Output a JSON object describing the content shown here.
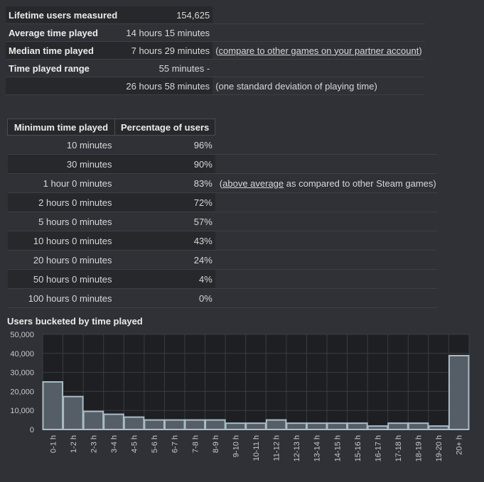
{
  "stats": {
    "rows": [
      {
        "label": "Lifetime users measured",
        "value": "154,625",
        "note": ""
      },
      {
        "label": "Average time played",
        "value": "14 hours 15 minutes",
        "note": ""
      },
      {
        "label": "Median time played",
        "value": "7 hours 29 minutes",
        "note_prefix": "(",
        "note_link": "compare to other games on your partner account",
        "note_suffix": ")"
      },
      {
        "label": "Time played range",
        "value": "55 minutes -",
        "note": ""
      },
      {
        "label": "",
        "value": "26 hours 58 minutes",
        "note": "(one standard deviation of playing time)"
      }
    ]
  },
  "time_played": {
    "headers": [
      "Minimum time played",
      "Percentage of users"
    ],
    "rows": [
      {
        "min": "10 minutes",
        "pct": "96%"
      },
      {
        "min": "30 minutes",
        "pct": "90%"
      },
      {
        "min": "1 hour 0 minutes",
        "pct": "83%",
        "note_prefix": "(",
        "note_link": "above average",
        "note_suffix": " as compared to other Steam games)"
      },
      {
        "min": "2 hours 0 minutes",
        "pct": "72%"
      },
      {
        "min": "5 hours 0 minutes",
        "pct": "57%"
      },
      {
        "min": "10 hours 0 minutes",
        "pct": "43%"
      },
      {
        "min": "20 hours 0 minutes",
        "pct": "24%"
      },
      {
        "min": "50 hours 0 minutes",
        "pct": "4%"
      },
      {
        "min": "100 hours 0 minutes",
        "pct": "0%"
      }
    ]
  },
  "chart_data": {
    "type": "bar",
    "title": "Users bucketed by time played",
    "xlabel": "",
    "ylabel": "",
    "ylim": [
      0,
      50000
    ],
    "yticks": [
      "0",
      "10,000",
      "20,000",
      "30,000",
      "40,000",
      "50,000"
    ],
    "grid": true,
    "categories": [
      "0-1 h",
      "1-2 h",
      "2-3 h",
      "3-4 h",
      "4-5 h",
      "5-6 h",
      "6-7 h",
      "7-8 h",
      "8-9 h",
      "9-10 h",
      "10-11 h",
      "11-12 h",
      "12-13 h",
      "13-14 h",
      "14-15 h",
      "15-16 h",
      "16-17 h",
      "17-18 h",
      "18-19 h",
      "19-20 h",
      "20+ h"
    ],
    "values": [
      25000,
      17300,
      9500,
      8000,
      6500,
      5000,
      5000,
      5000,
      5000,
      3300,
      3300,
      5000,
      3300,
      3300,
      3300,
      3300,
      1800,
      3300,
      3300,
      1800,
      38800
    ],
    "colors": {
      "bar_fill": "#555e66",
      "bar_stroke": "#a9bcc6",
      "plot_bg": "#1d1f22",
      "grid": "#3a3d42"
    }
  }
}
